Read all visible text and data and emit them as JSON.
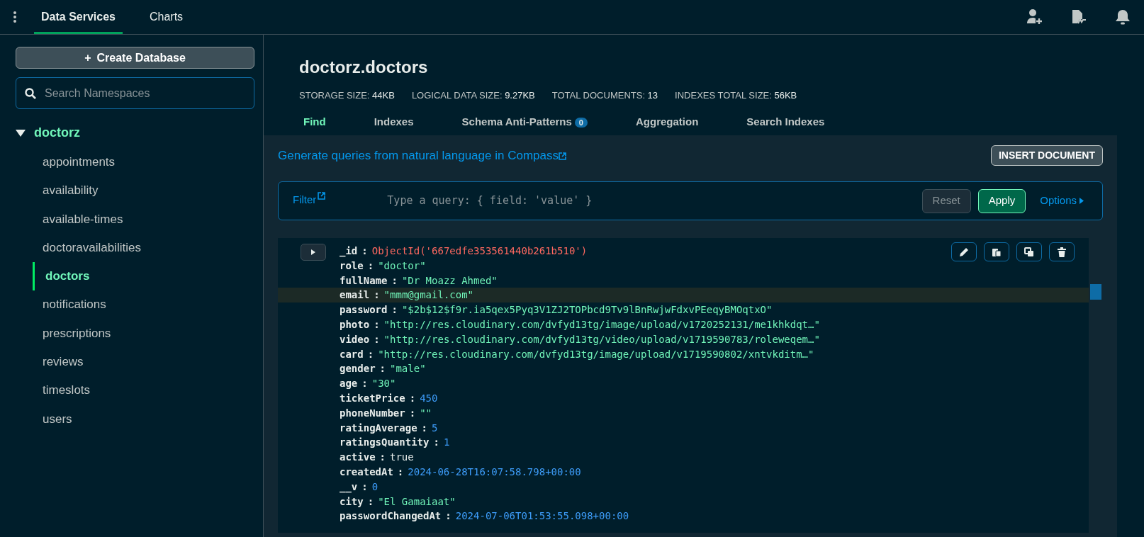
{
  "top_nav": {
    "tabs": [
      {
        "label": "Data Services",
        "selected": true
      },
      {
        "label": "Charts",
        "selected": false
      }
    ]
  },
  "sidebar": {
    "create_button": "Create Database",
    "create_icon": "+",
    "search": {
      "placeholder": "Search Namespaces"
    },
    "database": {
      "name": "doctorz",
      "expanded": true,
      "collections": [
        {
          "name": "appointments",
          "selected": false
        },
        {
          "name": "availability",
          "selected": false
        },
        {
          "name": "available-times",
          "selected": false
        },
        {
          "name": "doctoravailabilities",
          "selected": false
        },
        {
          "name": "doctors",
          "selected": true
        },
        {
          "name": "notifications",
          "selected": false
        },
        {
          "name": "prescriptions",
          "selected": false
        },
        {
          "name": "reviews",
          "selected": false
        },
        {
          "name": "timeslots",
          "selected": false
        },
        {
          "name": "users",
          "selected": false
        }
      ]
    }
  },
  "collection": {
    "title": "doctorz.doctors",
    "stats": [
      {
        "label": "STORAGE SIZE:",
        "value": "44KB"
      },
      {
        "label": "LOGICAL DATA SIZE:",
        "value": "9.27KB"
      },
      {
        "label": "TOTAL DOCUMENTS:",
        "value": "13"
      },
      {
        "label": "INDEXES TOTAL SIZE:",
        "value": "56KB"
      }
    ],
    "tabs": [
      {
        "label": "Find",
        "selected": true
      },
      {
        "label": "Indexes",
        "selected": false
      },
      {
        "label": "Schema Anti-Patterns",
        "selected": false,
        "badge": "0"
      },
      {
        "label": "Aggregation",
        "selected": false
      },
      {
        "label": "Search Indexes",
        "selected": false
      }
    ]
  },
  "query": {
    "compass_link": "Generate queries from natural language in Compass",
    "insert_button": "INSERT DOCUMENT",
    "filter_label": "Filter",
    "placeholder": "Type a query: { field: 'value' }",
    "reset_button": "Reset",
    "apply_button": "Apply",
    "options_button": "Options"
  },
  "document": {
    "separator": ":",
    "fields": [
      {
        "key": "_id",
        "value": "ObjectId('667edfe353561440b261b510')",
        "kind": "objectid",
        "highlighted": false
      },
      {
        "key": "role",
        "value": "\"doctor\"",
        "kind": "string",
        "highlighted": false
      },
      {
        "key": "fullName",
        "value": "\"Dr Moazz Ahmed\"",
        "kind": "string",
        "highlighted": false
      },
      {
        "key": "email",
        "value": "\"mmm@gmail.com\"",
        "kind": "string",
        "highlighted": true
      },
      {
        "key": "password",
        "value": "\"$2b$12$f9r.ia5qex5Pyq3V1ZJ2TOPbcd9Tv9lBnRwjwFdxvPEeqyBMOqtxO\"",
        "kind": "string",
        "highlighted": false
      },
      {
        "key": "photo",
        "value": "\"http://res.cloudinary.com/dvfyd13tg/image/upload/v1720252131/me1khkdqt…\"",
        "kind": "string",
        "highlighted": false
      },
      {
        "key": "video",
        "value": "\"http://res.cloudinary.com/dvfyd13tg/video/upload/v1719590783/roleweqem…\"",
        "kind": "string",
        "highlighted": false
      },
      {
        "key": "card",
        "value": "\"http://res.cloudinary.com/dvfyd13tg/image/upload/v1719590802/xntvkditm…\"",
        "kind": "string",
        "highlighted": false
      },
      {
        "key": "gender",
        "value": "\"male\"",
        "kind": "string",
        "highlighted": false
      },
      {
        "key": "age",
        "value": "\"30\"",
        "kind": "string",
        "highlighted": false
      },
      {
        "key": "ticketPrice",
        "value": "450",
        "kind": "number",
        "highlighted": false
      },
      {
        "key": "phoneNumber",
        "value": "\"\"",
        "kind": "string",
        "highlighted": false
      },
      {
        "key": "ratingAverage",
        "value": "5",
        "kind": "number",
        "highlighted": false
      },
      {
        "key": "ratingsQuantity",
        "value": "1",
        "kind": "number",
        "highlighted": false
      },
      {
        "key": "active",
        "value": "true",
        "kind": "boolean",
        "highlighted": false
      },
      {
        "key": "createdAt",
        "value": "2024-06-28T16:07:58.798+00:00",
        "kind": "date",
        "highlighted": false
      },
      {
        "key": "__v",
        "value": "0",
        "kind": "number",
        "highlighted": false
      },
      {
        "key": "city",
        "value": "\"El Gamaiaat\"",
        "kind": "string",
        "highlighted": false
      },
      {
        "key": "passwordChangedAt",
        "value": "2024-07-06T01:53:55.098+00:00",
        "kind": "date",
        "highlighted": false
      }
    ]
  }
}
